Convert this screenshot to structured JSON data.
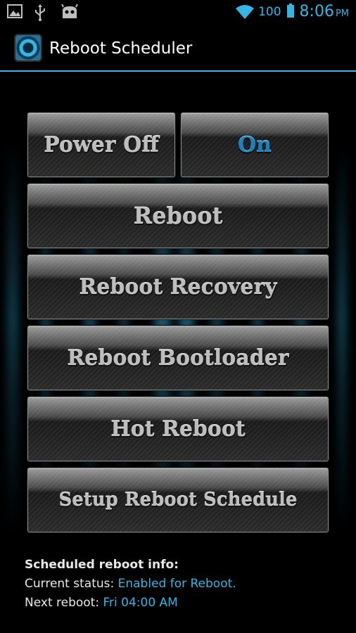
{
  "status_bar": {
    "battery_level": "100",
    "time": "8:06",
    "ampm": "PM",
    "icons_left": [
      "image-icon",
      "usb-icon",
      "cyanogenmod-icon"
    ],
    "icons_right": [
      "wifi-icon",
      "battery-icon"
    ]
  },
  "action_bar": {
    "title": "Reboot Scheduler"
  },
  "buttons": {
    "power_off": "Power Off",
    "on": "On",
    "reboot": "Reboot",
    "reboot_recovery": "Reboot Recovery",
    "reboot_bootloader": "Reboot Bootloader",
    "hot_reboot": "Hot Reboot",
    "setup_schedule": "Setup Reboot Schedule"
  },
  "info": {
    "title": "Scheduled reboot info:",
    "status_label": "Current status: ",
    "status_value": "Enabled for Reboot.",
    "next_label": "Next reboot: ",
    "next_value": "Fri 04:00 AM"
  },
  "colors": {
    "accent": "#33b5e5",
    "on_button_text": "#1c7fbf",
    "button_text": "#bdbdbd"
  }
}
